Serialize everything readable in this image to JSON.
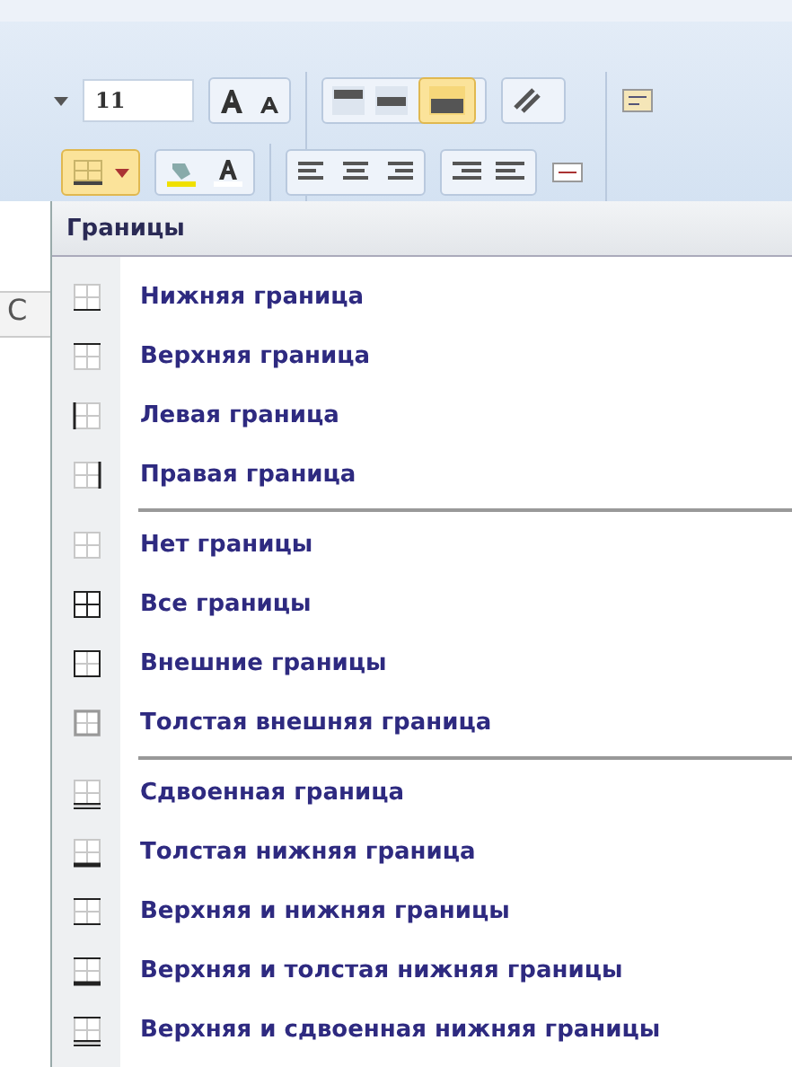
{
  "ribbon": {
    "font_size": "11"
  },
  "sheet": {
    "column_header": "C"
  },
  "menu": {
    "title": "Границы",
    "groups": [
      [
        {
          "label": "Нижняя граница",
          "kind": "bottom"
        },
        {
          "label": "Верхняя граница",
          "kind": "top"
        },
        {
          "label": "Левая граница",
          "kind": "left"
        },
        {
          "label": "Правая граница",
          "kind": "right"
        }
      ],
      [
        {
          "label": "Нет границы",
          "kind": "none"
        },
        {
          "label": "Все границы",
          "kind": "all"
        },
        {
          "label": "Внешние границы",
          "kind": "outside"
        },
        {
          "label": "Толстая внешняя граница",
          "kind": "thick_outside"
        }
      ],
      [
        {
          "label": "Сдвоенная граница",
          "kind": "double_bottom"
        },
        {
          "label": "Толстая нижняя граница",
          "kind": "thick_bottom"
        },
        {
          "label": "Верхняя и нижняя границы",
          "kind": "top_bottom"
        },
        {
          "label": "Верхняя и толстая нижняя границы",
          "kind": "top_thick_bottom"
        },
        {
          "label": "Верхняя и сдвоенная нижняя границы",
          "kind": "top_double_bottom"
        }
      ]
    ]
  }
}
